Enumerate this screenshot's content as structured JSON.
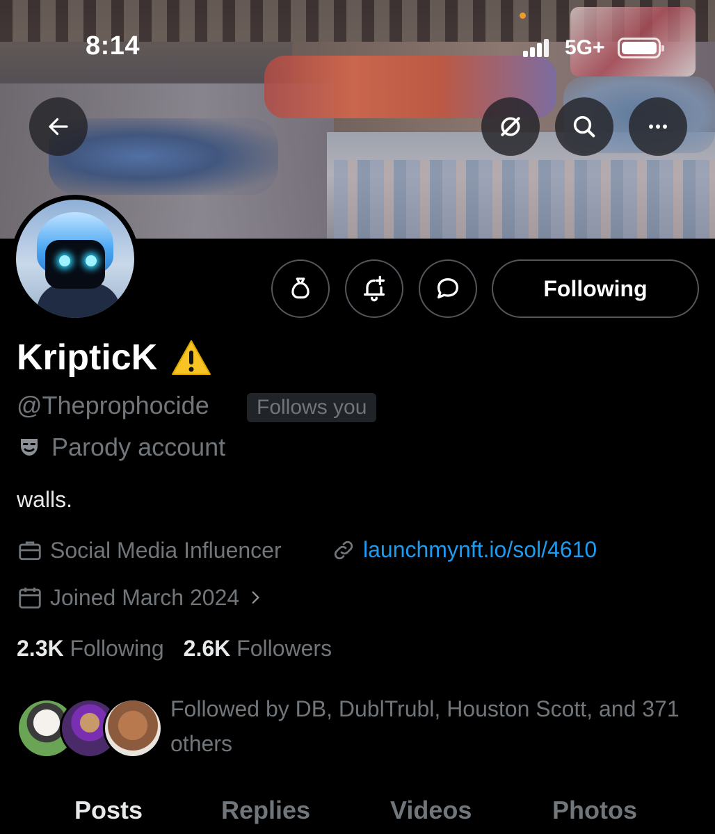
{
  "status_bar": {
    "time": "8:14",
    "network": "5G+",
    "icons": [
      "signal-icon",
      "battery-icon"
    ]
  },
  "header": {
    "buttons": [
      {
        "name": "back-button",
        "icon": "arrow-left-icon"
      },
      {
        "name": "grok-button",
        "icon": "grok-icon"
      },
      {
        "name": "search-button",
        "icon": "search-icon"
      },
      {
        "name": "more-button",
        "icon": "more-horizontal-icon"
      }
    ]
  },
  "actions": {
    "tip_icon": "money-bag-icon",
    "notify_icon": "bell-plus-icon",
    "message_icon": "chat-bubble-icon",
    "following_label": "Following"
  },
  "profile": {
    "display_name": "KripticK",
    "warning_emoji": "⚠️",
    "handle": "@Theprophocide",
    "follows_you": "Follows you",
    "parody_label": "Parody account",
    "bio": "walls.",
    "category": "Social Media Influencer",
    "link": "launchmynft.io/sol/4610",
    "joined": "Joined March 2024",
    "following_count": "2.3K",
    "following_label": "Following",
    "followers_count": "2.6K",
    "followers_label": "Followers",
    "followed_by": "Followed by DB, DublTrubl, Houston Scott, and 371 others"
  },
  "tabs": [
    {
      "label": "Posts",
      "active": true
    },
    {
      "label": "Replies",
      "active": false
    },
    {
      "label": "Videos",
      "active": false
    },
    {
      "label": "Photos",
      "active": false
    }
  ],
  "colors": {
    "background": "#000000",
    "text_primary": "#e7e9ea",
    "text_secondary": "#71767b",
    "link": "#1d9bf0",
    "border": "#53575c"
  }
}
